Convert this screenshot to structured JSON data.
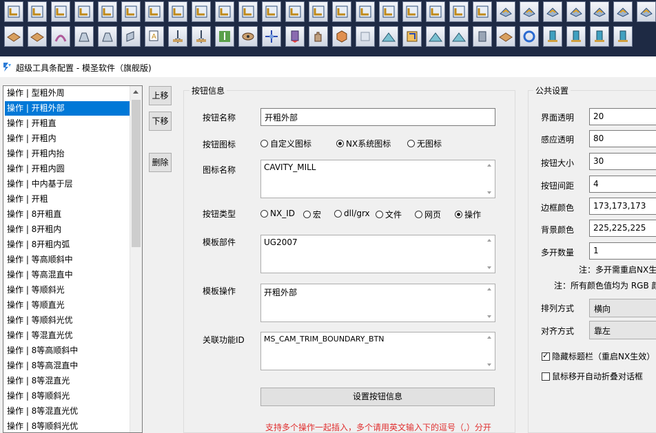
{
  "window": {
    "title": "超级工具条配置 - 模圣软件（旗舰版)"
  },
  "toolbar": {
    "row1_icons": [
      "cavity-mill-icon",
      "cavity-mill-icon",
      "cavity-mill-icon",
      "cavity-mill-icon",
      "cavity-mill-icon",
      "cavity-mill-icon",
      "cavity-mill-icon",
      "cavity-mill-icon",
      "cavity-mill-icon",
      "cavity-mill-icon",
      "cavity-mill-icon",
      "cavity-mill-icon",
      "cavity-mill-icon",
      "cavity-mill-icon",
      "cavity-mill-icon",
      "cavity-mill-icon",
      "cavity-mill-icon",
      "cavity-mill-icon",
      "cavity-mill-icon",
      "cavity-mill-icon",
      "cavity-mill-icon",
      "zlevel-icon",
      "zlevel-icon",
      "zlevel-icon",
      "zlevel-icon",
      "zlevel-icon",
      "zlevel-icon",
      "zlevel-icon"
    ],
    "row2_icons": [
      "plate-icon",
      "plate-icon",
      "arc-icon",
      "contour-icon",
      "contour-icon",
      "wall-icon",
      "text-engrave-icon",
      "drill-icon",
      "drill-icon",
      "pocket-icon",
      "eye-icon",
      "move-icon",
      "cutter-icon",
      "hand-icon",
      "cube-icon",
      "blank-icon",
      "mountain-icon",
      "chamfer-icon",
      "mountain-icon",
      "mountain-icon",
      "prism-icon",
      "plate-icon",
      "rotate-icon",
      "post-icon",
      "post-icon",
      "post-icon",
      "post-icon"
    ]
  },
  "list": {
    "items": [
      "操作 | 型粗外周",
      "操作 | 开粗外部",
      "操作 | 开粗直",
      "操作 | 开粗内",
      "操作 | 开粗内抬",
      "操作 | 开粗内圆",
      "操作 | 中内基于层",
      "操作 | 开粗",
      "操作 | 8开粗直",
      "操作 | 8开粗内",
      "操作 | 8开粗内弧",
      "操作 | 等高顺斜中",
      "操作 | 等高混直中",
      "操作 | 等顺斜光",
      "操作 | 等顺直光",
      "操作 | 等顺斜光优",
      "操作 | 等混直光优",
      "操作 | 8等高顺斜中",
      "操作 | 8等高混直中",
      "操作 | 8等混直光",
      "操作 | 8等顺斜光",
      "操作 | 8等混直光优",
      "操作 | 8等顺斜光优"
    ],
    "selected_index": 1
  },
  "buttons": {
    "move_up": "上移",
    "move_down": "下移",
    "delete": "删除",
    "set_info": "设置按钮信息"
  },
  "button_info": {
    "title": "按钮信息",
    "name_label": "按钮名称",
    "name_value": "开粗外部",
    "icon_label": "按钮图标",
    "icon_options": [
      "自定义图标",
      "NX系统图标",
      "无图标"
    ],
    "icon_selected": 1,
    "icon_name_label": "图标名称",
    "icon_name_value": "CAVITY_MILL",
    "type_label": "按钮类型",
    "type_options": [
      "NX_ID",
      "宏",
      "dll/grx",
      "文件",
      "网页",
      "操作"
    ],
    "type_selected": 5,
    "template_part_label": "模板部件",
    "template_part_value": "UG2007",
    "template_op_label": "模板操作",
    "template_op_value": "开粗外部",
    "func_id_label": "关联功能ID",
    "func_id_value": "MS_CAM_TRIM_BOUNDARY_BTN",
    "hint": "支持多个操作一起插入，多个请用英文输入下的逗号（,）分开"
  },
  "public": {
    "title": "公共设置",
    "transparency_label": "界面透明",
    "transparency_value": "20",
    "sense_label": "感应透明",
    "sense_value": "80",
    "size_label": "按钮大小",
    "size_value": "30",
    "spacing_label": "按钮间距",
    "spacing_value": "4",
    "border_color_label": "边框颜色",
    "border_color_value": "173,173,173",
    "bg_color_label": "背景颜色",
    "bg_color_value": "225,225,225",
    "multi_label": "多开数量",
    "multi_value": "1",
    "note1": "注：多开需重启NX生效",
    "note2": "注：所有颜色值均为 RGB 颜色",
    "arrange_label": "排列方式",
    "arrange_value": "横向",
    "align_label": "对齐方式",
    "align_value": "靠左",
    "hide_title_label": "隐藏标题栏（重启NX生效）",
    "hide_title_checked": true,
    "auto_fold_label": "鼠标移开自动折叠对话框",
    "auto_fold_checked": false
  },
  "colors": {
    "toolbar_bg": "#1e2a44",
    "selection": "#0078d7",
    "hint_red": "#e03030"
  }
}
